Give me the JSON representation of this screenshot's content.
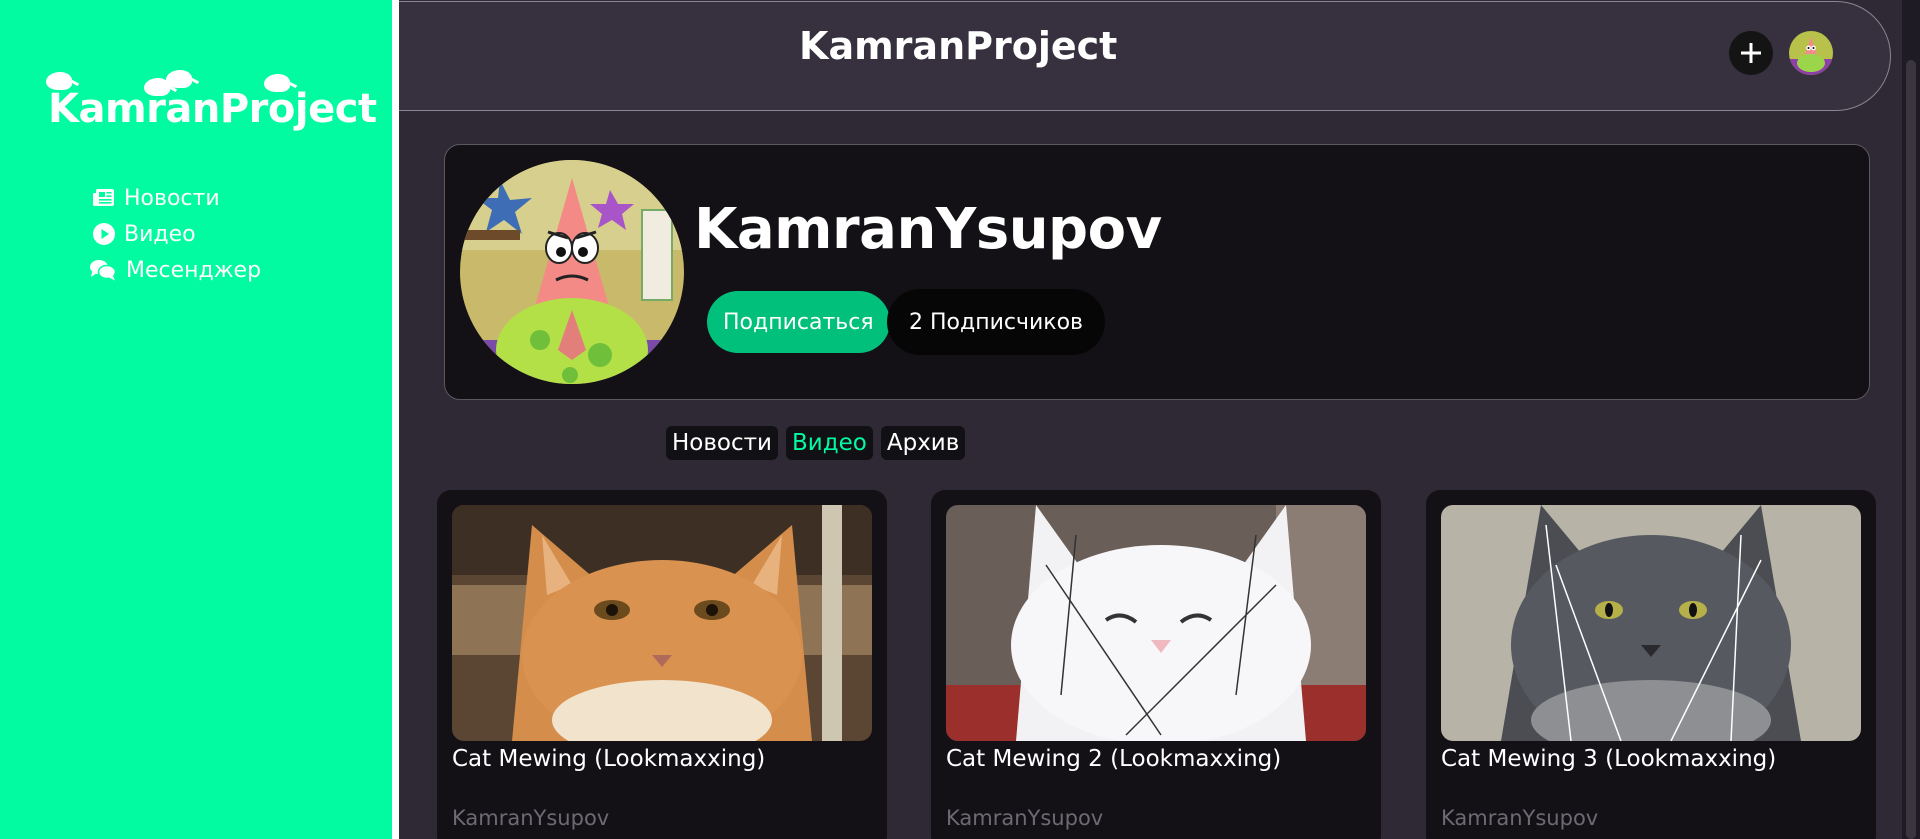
{
  "sidebar": {
    "logo": "KamranProject",
    "items": [
      {
        "label": "Новости",
        "icon": "newspaper-icon"
      },
      {
        "label": "Видео",
        "icon": "play-circle-icon"
      },
      {
        "label": "Месенджер",
        "icon": "chat-bubbles-icon"
      }
    ]
  },
  "header": {
    "title": "KamranProject",
    "add_icon": "plus-icon",
    "avatar": "user-avatar"
  },
  "profile": {
    "name": "KamranYsupov",
    "subscribe_label": "Подписаться",
    "subscribers_label": "2 Подписчиков"
  },
  "tabs": [
    {
      "label": "Новости",
      "active": false
    },
    {
      "label": "Видео",
      "active": true
    },
    {
      "label": "Архив",
      "active": false
    }
  ],
  "videos": [
    {
      "title": "Cat Mewing (Lookmaxxing)",
      "author": "KamranYsupov"
    },
    {
      "title": "Cat Mewing 2 (Lookmaxxing)",
      "author": "KamranYsupov"
    },
    {
      "title": "Cat Mewing 3 (Lookmaxxing)",
      "author": "KamranYsupov"
    }
  ],
  "colors": {
    "accent": "#02fba1",
    "subscribe": "#00c07c",
    "background": "#2e2935",
    "card": "#141116"
  }
}
